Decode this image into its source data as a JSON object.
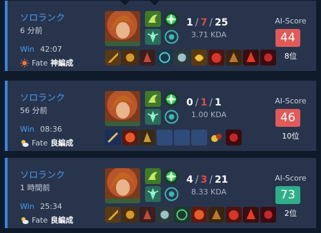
{
  "matches": [
    {
      "queue": "ソロランク",
      "time_ago": "6 分前",
      "result": "Win",
      "duration": "42:07",
      "fate_label": "Fate",
      "fate_tier": "神編成",
      "fate_icon": "sun-icon",
      "kills": "1",
      "deaths": "7",
      "assists": "25",
      "kda_ratio": "3.71 KDA",
      "ai_label": "AI-Score",
      "ai_score": "44",
      "ai_color": "#e05a5a",
      "rank": "8位",
      "items": [
        "item",
        "item",
        "item",
        "item",
        "item",
        "item",
        "item",
        "item",
        "item",
        "item"
      ]
    },
    {
      "queue": "ソロランク",
      "time_ago": "56 分前",
      "result": "Win",
      "duration": "08:36",
      "fate_label": "Fate",
      "fate_tier": "良編成",
      "fate_icon": "partly-cloudy-icon",
      "kills": "0",
      "deaths": "1",
      "assists": "1",
      "kda_ratio": "1.00 KDA",
      "ai_label": "AI-Score",
      "ai_score": "46",
      "ai_color": "#e05a5a",
      "rank": "10位",
      "items": [
        "item",
        "item",
        "item",
        "empty",
        "empty",
        "empty",
        "item",
        "item"
      ]
    },
    {
      "queue": "ソロランク",
      "time_ago": "1 時間前",
      "result": "Win",
      "duration": "25:34",
      "fate_label": "Fate",
      "fate_tier": "良編成",
      "fate_icon": "partly-cloudy-icon",
      "kills": "4",
      "deaths": "3",
      "assists": "21",
      "kda_ratio": "8.33 KDA",
      "ai_label": "AI-Score",
      "ai_score": "73",
      "ai_color": "#2fae8a",
      "rank": "2位",
      "items": [
        "item",
        "item",
        "item",
        "item",
        "item",
        "item",
        "item",
        "item",
        "item",
        "item"
      ]
    }
  ]
}
